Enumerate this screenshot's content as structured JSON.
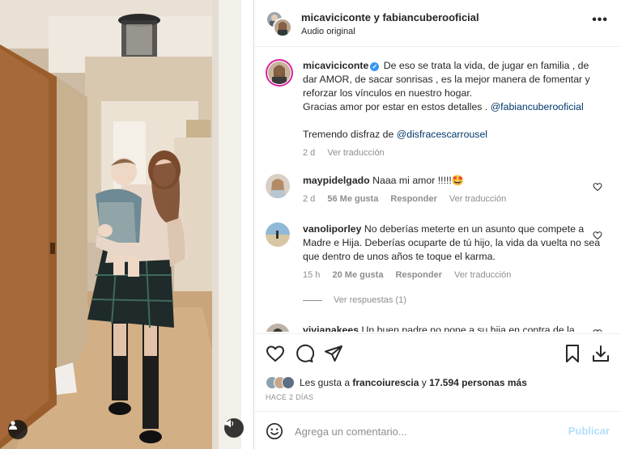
{
  "header": {
    "users": "micaviciconte y fabiancuberooficial",
    "audio": "Audio original",
    "more_icon": "more-horizontal-icon"
  },
  "caption": {
    "username": "micaviciconte",
    "verified": true,
    "text_1": "De eso se trata la vida, de jugar en familia , de dar AMOR, de sacar sonrisas , es la mejor manera de fomentar y reforzar los vínculos en nuestro hogar.",
    "text_2": "Gracias amor por estar en estos detalles .",
    "mention_1": "@fabiancuberooficial",
    "text_3": "Tremendo disfraz de",
    "mention_2": "@disfracescarrousel",
    "time": "2 d",
    "see_translation": "Ver traducción"
  },
  "comments": [
    {
      "username": "maypidelgado",
      "text": "Naaa mi amor !!!!!",
      "emoji": "🤩",
      "time": "2 d",
      "likes": "56 Me gusta",
      "reply": "Responder",
      "see_translation": "Ver traducción"
    },
    {
      "username": "vanoliporley",
      "text": "No deberías meterte en un asunto que compete a Madre e Hija. Deberías ocuparte de tú hijo, la vida da vuelta no sea que dentro de unos años te toque el karma.",
      "time": "15 h",
      "likes": "20 Me gusta",
      "reply": "Responder",
      "see_translation": "Ver traducción",
      "view_replies": "Ver respuestas (1)"
    },
    {
      "username": "vivianakees",
      "text": "Un buen padre no pone a su hija en contra de la"
    }
  ],
  "likes": {
    "prefix": "Les gusta a",
    "user": "francoiurescia",
    "middle": "y",
    "count": "17.594 personas más"
  },
  "post_time": "HACE 2 DÍAS",
  "comment_bar": {
    "placeholder": "Agrega un comentario...",
    "publish": "Publicar"
  },
  "colors": {
    "link": "#00376b",
    "verified": "#3897f0",
    "muted": "#8e8e8e",
    "publish_disabled": "#b2dffc"
  }
}
